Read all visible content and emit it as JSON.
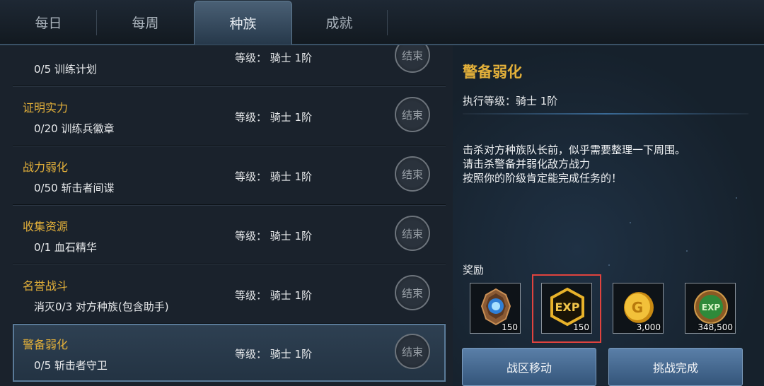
{
  "tabs": [
    {
      "label": "每日"
    },
    {
      "label": "每周"
    },
    {
      "label": "种族"
    },
    {
      "label": "成就"
    }
  ],
  "active_tab": "种族",
  "quests": [
    {
      "title": "",
      "progress": "0/5 训练计划",
      "level": "等级： 骑士 1阶",
      "button": "结束"
    },
    {
      "title": "证明实力",
      "progress": "0/20 训练兵徽章",
      "level": "等级： 骑士 1阶",
      "button": "结束"
    },
    {
      "title": "战力弱化",
      "progress": "0/50 斩击者间谍",
      "level": "等级： 骑士 1阶",
      "button": "结束"
    },
    {
      "title": "收集资源",
      "progress": "0/1 血石精华",
      "level": "等级： 骑士 1阶",
      "button": "结束"
    },
    {
      "title": "名誉战斗",
      "progress": "消灭0/3 对方种族(包含助手)",
      "level": "等级： 骑士 1阶",
      "button": "结束"
    },
    {
      "title": "警备弱化",
      "progress": "0/5 斩击者守卫",
      "level": "等级： 骑士 1阶",
      "button": "结束"
    }
  ],
  "detail": {
    "title": "警备弱化",
    "exec_level": "执行等级：骑士 1阶",
    "description": [
      "击杀对方种族队长前，似乎需要整理一下周围。",
      "请击杀警备并弱化敌方战力",
      "按照你的阶级肯定能完成任务的！"
    ],
    "rewards_label": "奖励",
    "rewards": [
      {
        "icon": "medal-icon",
        "amount": "150"
      },
      {
        "icon": "exp-icon",
        "amount": "150"
      },
      {
        "icon": "gold-coin-icon",
        "amount": "3,000"
      },
      {
        "icon": "exp-orb-icon",
        "amount": "348,500"
      }
    ],
    "buttons": {
      "move": "战区移动",
      "complete": "挑战完成"
    }
  },
  "colors": {
    "accent_gold": "#e3b03a",
    "highlight_red": "#e0433e",
    "button_blue": "#4a6e96"
  }
}
